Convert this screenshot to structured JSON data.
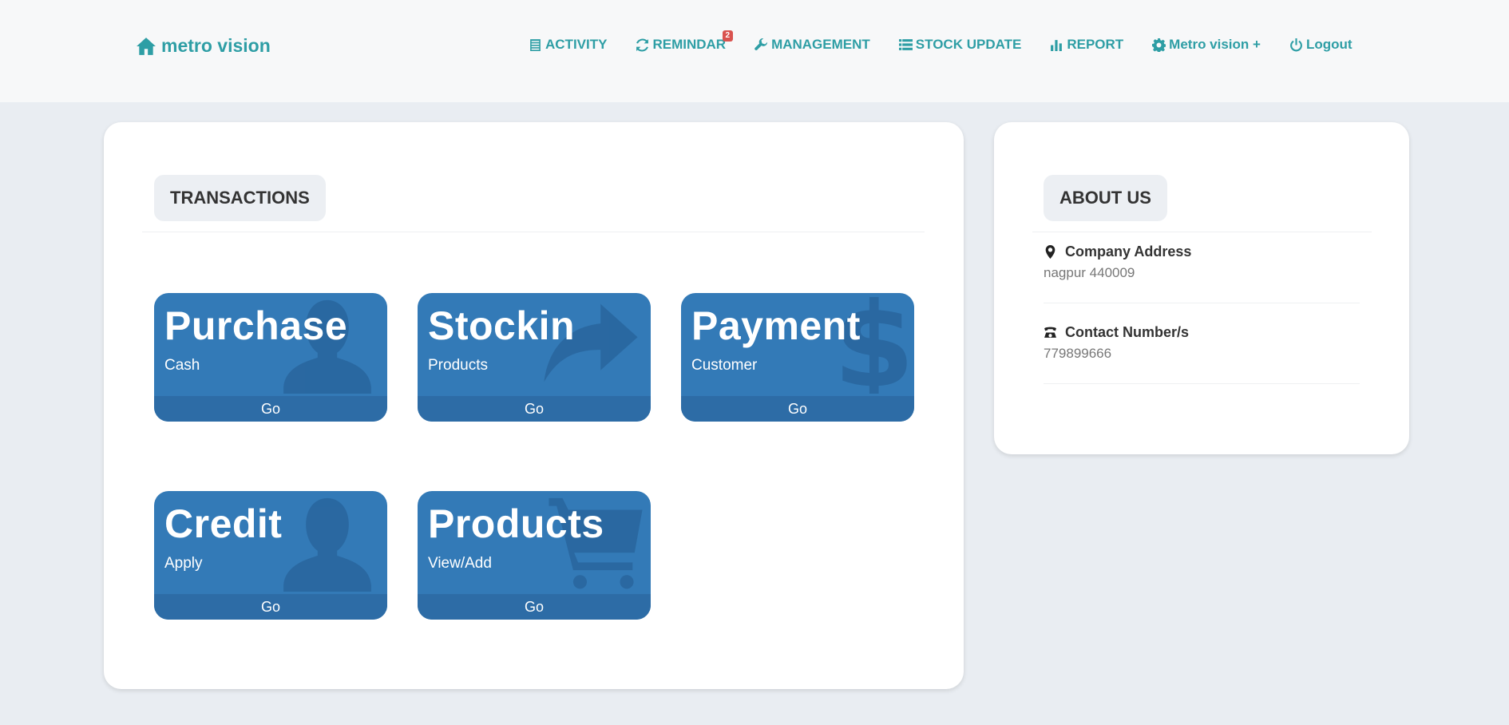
{
  "brand": {
    "label": "metro vision",
    "icon": "home-icon"
  },
  "nav": [
    {
      "label": "ACTIVITY",
      "icon": "list-alt-icon"
    },
    {
      "label": "REMINDAR",
      "icon": "refresh-icon",
      "badge": "2"
    },
    {
      "label": "MANAGEMENT",
      "icon": "wrench-icon"
    },
    {
      "label": "STOCK UPDATE",
      "icon": "list-icon"
    },
    {
      "label": "REPORT",
      "icon": "bar-chart-icon"
    },
    {
      "label": "Metro vision +",
      "icon": "gear-icon"
    },
    {
      "label": "Logout",
      "icon": "power-icon"
    }
  ],
  "transactions": {
    "heading": "TRANSACTIONS",
    "tiles": [
      {
        "title": "Purchase",
        "subtitle": "Cash",
        "action": "Go",
        "icon": "user-icon"
      },
      {
        "title": "Stockin",
        "subtitle": "Products",
        "action": "Go",
        "icon": "share-arrow-icon"
      },
      {
        "title": "Payment",
        "subtitle": "Customer",
        "action": "Go",
        "icon": "dollar-icon"
      },
      {
        "title": "Credit",
        "subtitle": "Apply",
        "action": "Go",
        "icon": "user-icon"
      },
      {
        "title": "Products",
        "subtitle": "View/Add",
        "action": "Go",
        "icon": "shopping-cart-icon"
      }
    ]
  },
  "about": {
    "heading": "ABOUT US",
    "address_label": "Company Address",
    "address_value": "nagpur 440009",
    "contact_label": "Contact Number/s",
    "contact_value": "779899666"
  },
  "colors": {
    "accent": "#2e9ea5",
    "tile": "#337ab7",
    "badge": "#d9534f",
    "background": "#e9edf2"
  }
}
